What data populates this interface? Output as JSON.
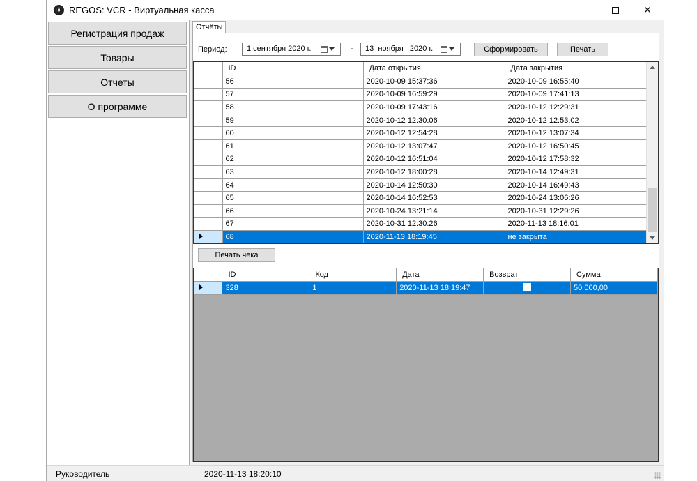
{
  "window": {
    "title": "REGOS: VCR - Виртуальная касса"
  },
  "sidebar": {
    "items": [
      {
        "label": "Регистрация продаж"
      },
      {
        "label": "Товары"
      },
      {
        "label": "Отчеты"
      },
      {
        "label": "О программе"
      }
    ]
  },
  "tabs": [
    {
      "label": "Отчёты"
    }
  ],
  "period": {
    "label": "Период:",
    "from": "1 сентября 2020 г.",
    "separator": "-",
    "to": "13  ноября   2020 г.",
    "generate_label": "Сформировать",
    "print_label": "Печать"
  },
  "shifts": {
    "columns": [
      "ID",
      "Дата открытия",
      "Дата закрытия"
    ],
    "rows": [
      [
        "56",
        "2020-10-09 15:37:36",
        "2020-10-09 16:55:40"
      ],
      [
        "57",
        "2020-10-09 16:59:29",
        "2020-10-09 17:41:13"
      ],
      [
        "58",
        "2020-10-09 17:43:16",
        "2020-10-12 12:29:31"
      ],
      [
        "59",
        "2020-10-12 12:30:06",
        "2020-10-12 12:53:02"
      ],
      [
        "60",
        "2020-10-12 12:54:28",
        "2020-10-12 13:07:34"
      ],
      [
        "61",
        "2020-10-12 13:07:47",
        "2020-10-12 16:50:45"
      ],
      [
        "62",
        "2020-10-12 16:51:04",
        "2020-10-12 17:58:32"
      ],
      [
        "63",
        "2020-10-12 18:00:28",
        "2020-10-14 12:49:31"
      ],
      [
        "64",
        "2020-10-14 12:50:30",
        "2020-10-14 16:49:43"
      ],
      [
        "65",
        "2020-10-14 16:52:53",
        "2020-10-24 13:06:26"
      ],
      [
        "66",
        "2020-10-24 13:21:14",
        "2020-10-31 12:29:26"
      ],
      [
        "67",
        "2020-10-31 12:30:26",
        "2020-11-13 18:16:01"
      ],
      [
        "68",
        "2020-11-13 18:19:45",
        "не закрыта"
      ]
    ],
    "selected_row": 12
  },
  "receipt_print_label": "Печать чека",
  "receipts": {
    "columns": [
      "ID",
      "Код",
      "Дата",
      "Возврат",
      "Сумма"
    ],
    "rows": [
      {
        "id": "328",
        "code": "1",
        "date": "2020-11-13 18:19:47",
        "return": false,
        "sum": "50 000,00"
      }
    ]
  },
  "status": {
    "role": "Руководитель",
    "datetime": "2020-11-13 18:20:10"
  },
  "colors": {
    "selection": "#0078d7",
    "empty_grid": "#ababab"
  }
}
